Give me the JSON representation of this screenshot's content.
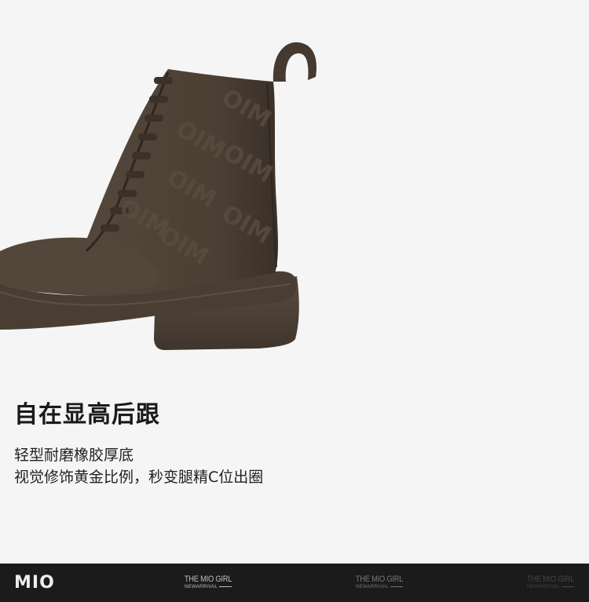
{
  "product": {
    "image_icon": "boot-icon",
    "headline": "自在显高后跟",
    "description": [
      "轻型耐磨橡胶厚底",
      "视觉修饰黄金比例，秒变腿精C位出圈"
    ]
  },
  "footer": {
    "logo": "MIO",
    "tags": [
      {
        "title": "THE MIO GIRL",
        "subtitle": "NEWARRIVAL"
      },
      {
        "title": "THE MIO GIRL",
        "subtitle": "NEWARRIVAL"
      },
      {
        "title": "THE MIO GIRL",
        "subtitle": "NEWARRIVAL"
      }
    ]
  },
  "colors": {
    "background": "#f5f5f5",
    "boot": "#4e4136",
    "footer": "#1b1b1b"
  }
}
